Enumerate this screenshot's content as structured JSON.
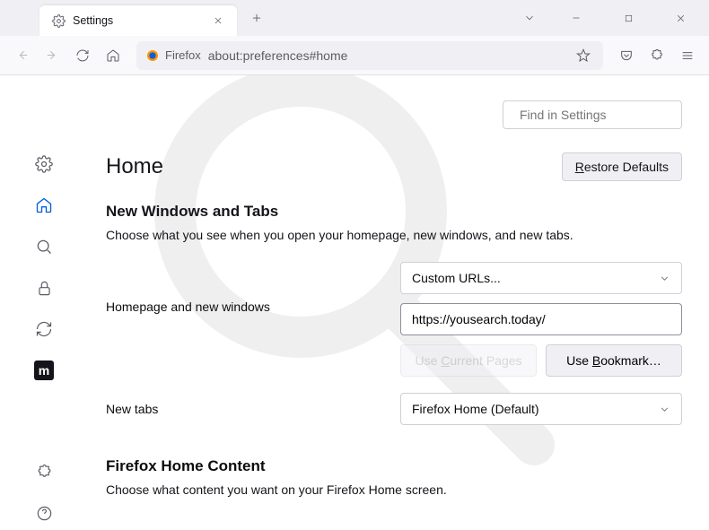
{
  "tab": {
    "title": "Settings"
  },
  "urlbar": {
    "identity": "Firefox",
    "url": "about:preferences#home"
  },
  "search": {
    "placeholder": "Find in Settings"
  },
  "page": {
    "heading": "Home",
    "restore_btn": "Restore Defaults"
  },
  "section1": {
    "title": "New Windows and Tabs",
    "desc": "Choose what you see when you open your homepage, new windows, and new tabs.",
    "homepage_label": "Homepage and new windows",
    "homepage_dropdown": "Custom URLs...",
    "homepage_url": "https://yousearch.today/",
    "use_current": "Use Current Pages",
    "use_bookmark": "Use Bookmark…",
    "newtabs_label": "New tabs",
    "newtabs_dropdown": "Firefox Home (Default)"
  },
  "section2": {
    "title": "Firefox Home Content",
    "desc": "Choose what content you want on your Firefox Home screen."
  },
  "sidebar": {
    "items": [
      "general",
      "home",
      "search",
      "privacy",
      "sync",
      "more",
      "extensions",
      "help"
    ]
  }
}
